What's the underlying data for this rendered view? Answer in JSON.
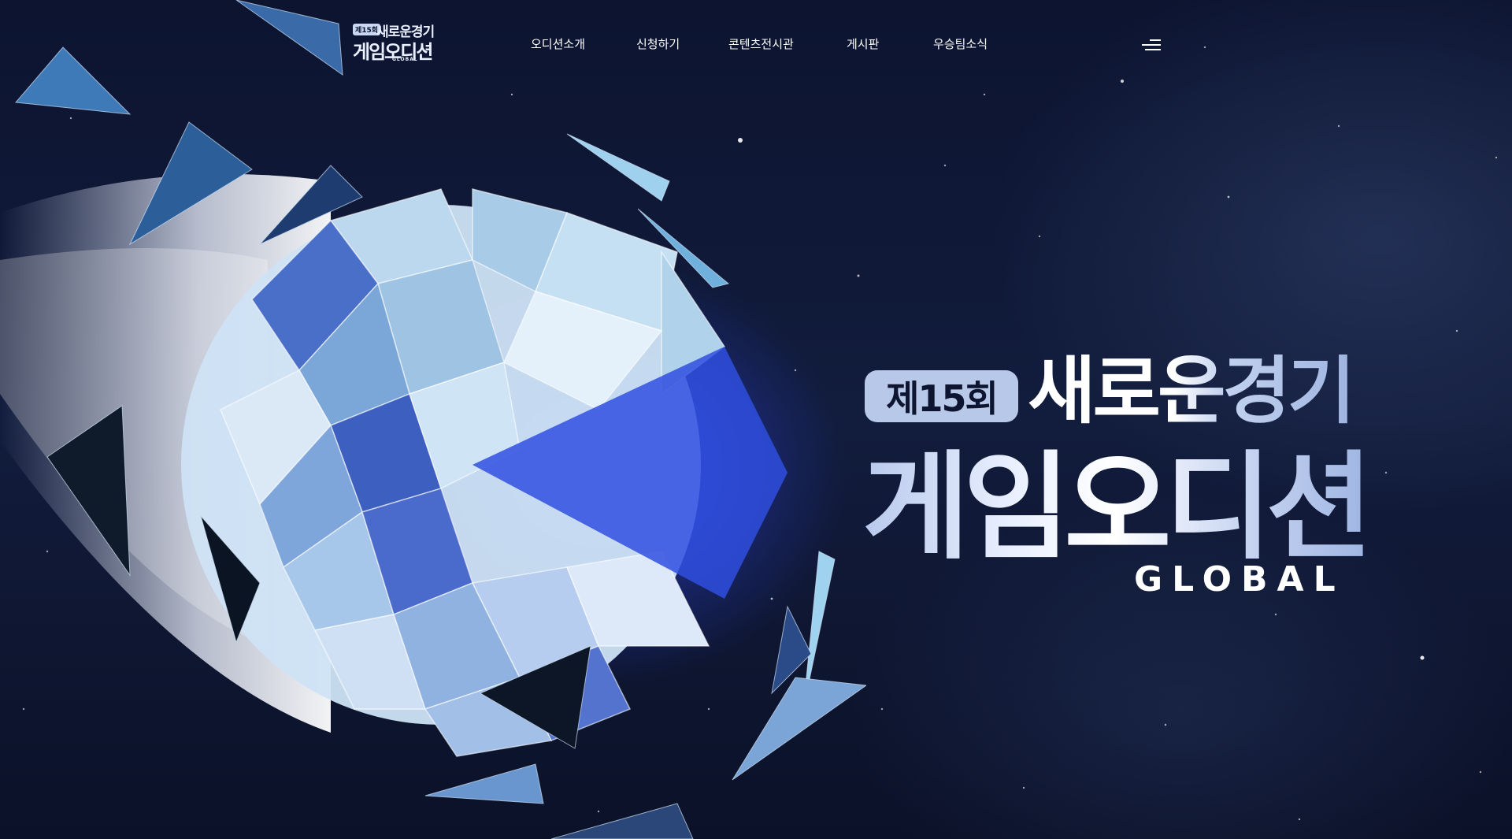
{
  "header": {
    "logo": {
      "badge": "제15회",
      "line1": "새로운경기",
      "line2": "게임오디션",
      "line3": "GLOBAL"
    },
    "nav": [
      {
        "label": "오디션소개"
      },
      {
        "label": "신청하기"
      },
      {
        "label": "콘텐츠전시관"
      },
      {
        "label": "게시판"
      },
      {
        "label": "우승팀소식"
      }
    ],
    "menu_icon": "hamburger-menu-icon"
  },
  "hero": {
    "badge": "제15회",
    "title_line1": "새로운경기",
    "title_line2": "게임오디션",
    "subtitle": "GLOBAL"
  },
  "colors": {
    "background": "#0d1530",
    "glow": "#3c5aff",
    "title_light": "#ffffff",
    "title_blue": "#9eb4e0",
    "badge_bg": "#b7c8e8"
  },
  "illustration": "shattered-crystal-planet-icon"
}
